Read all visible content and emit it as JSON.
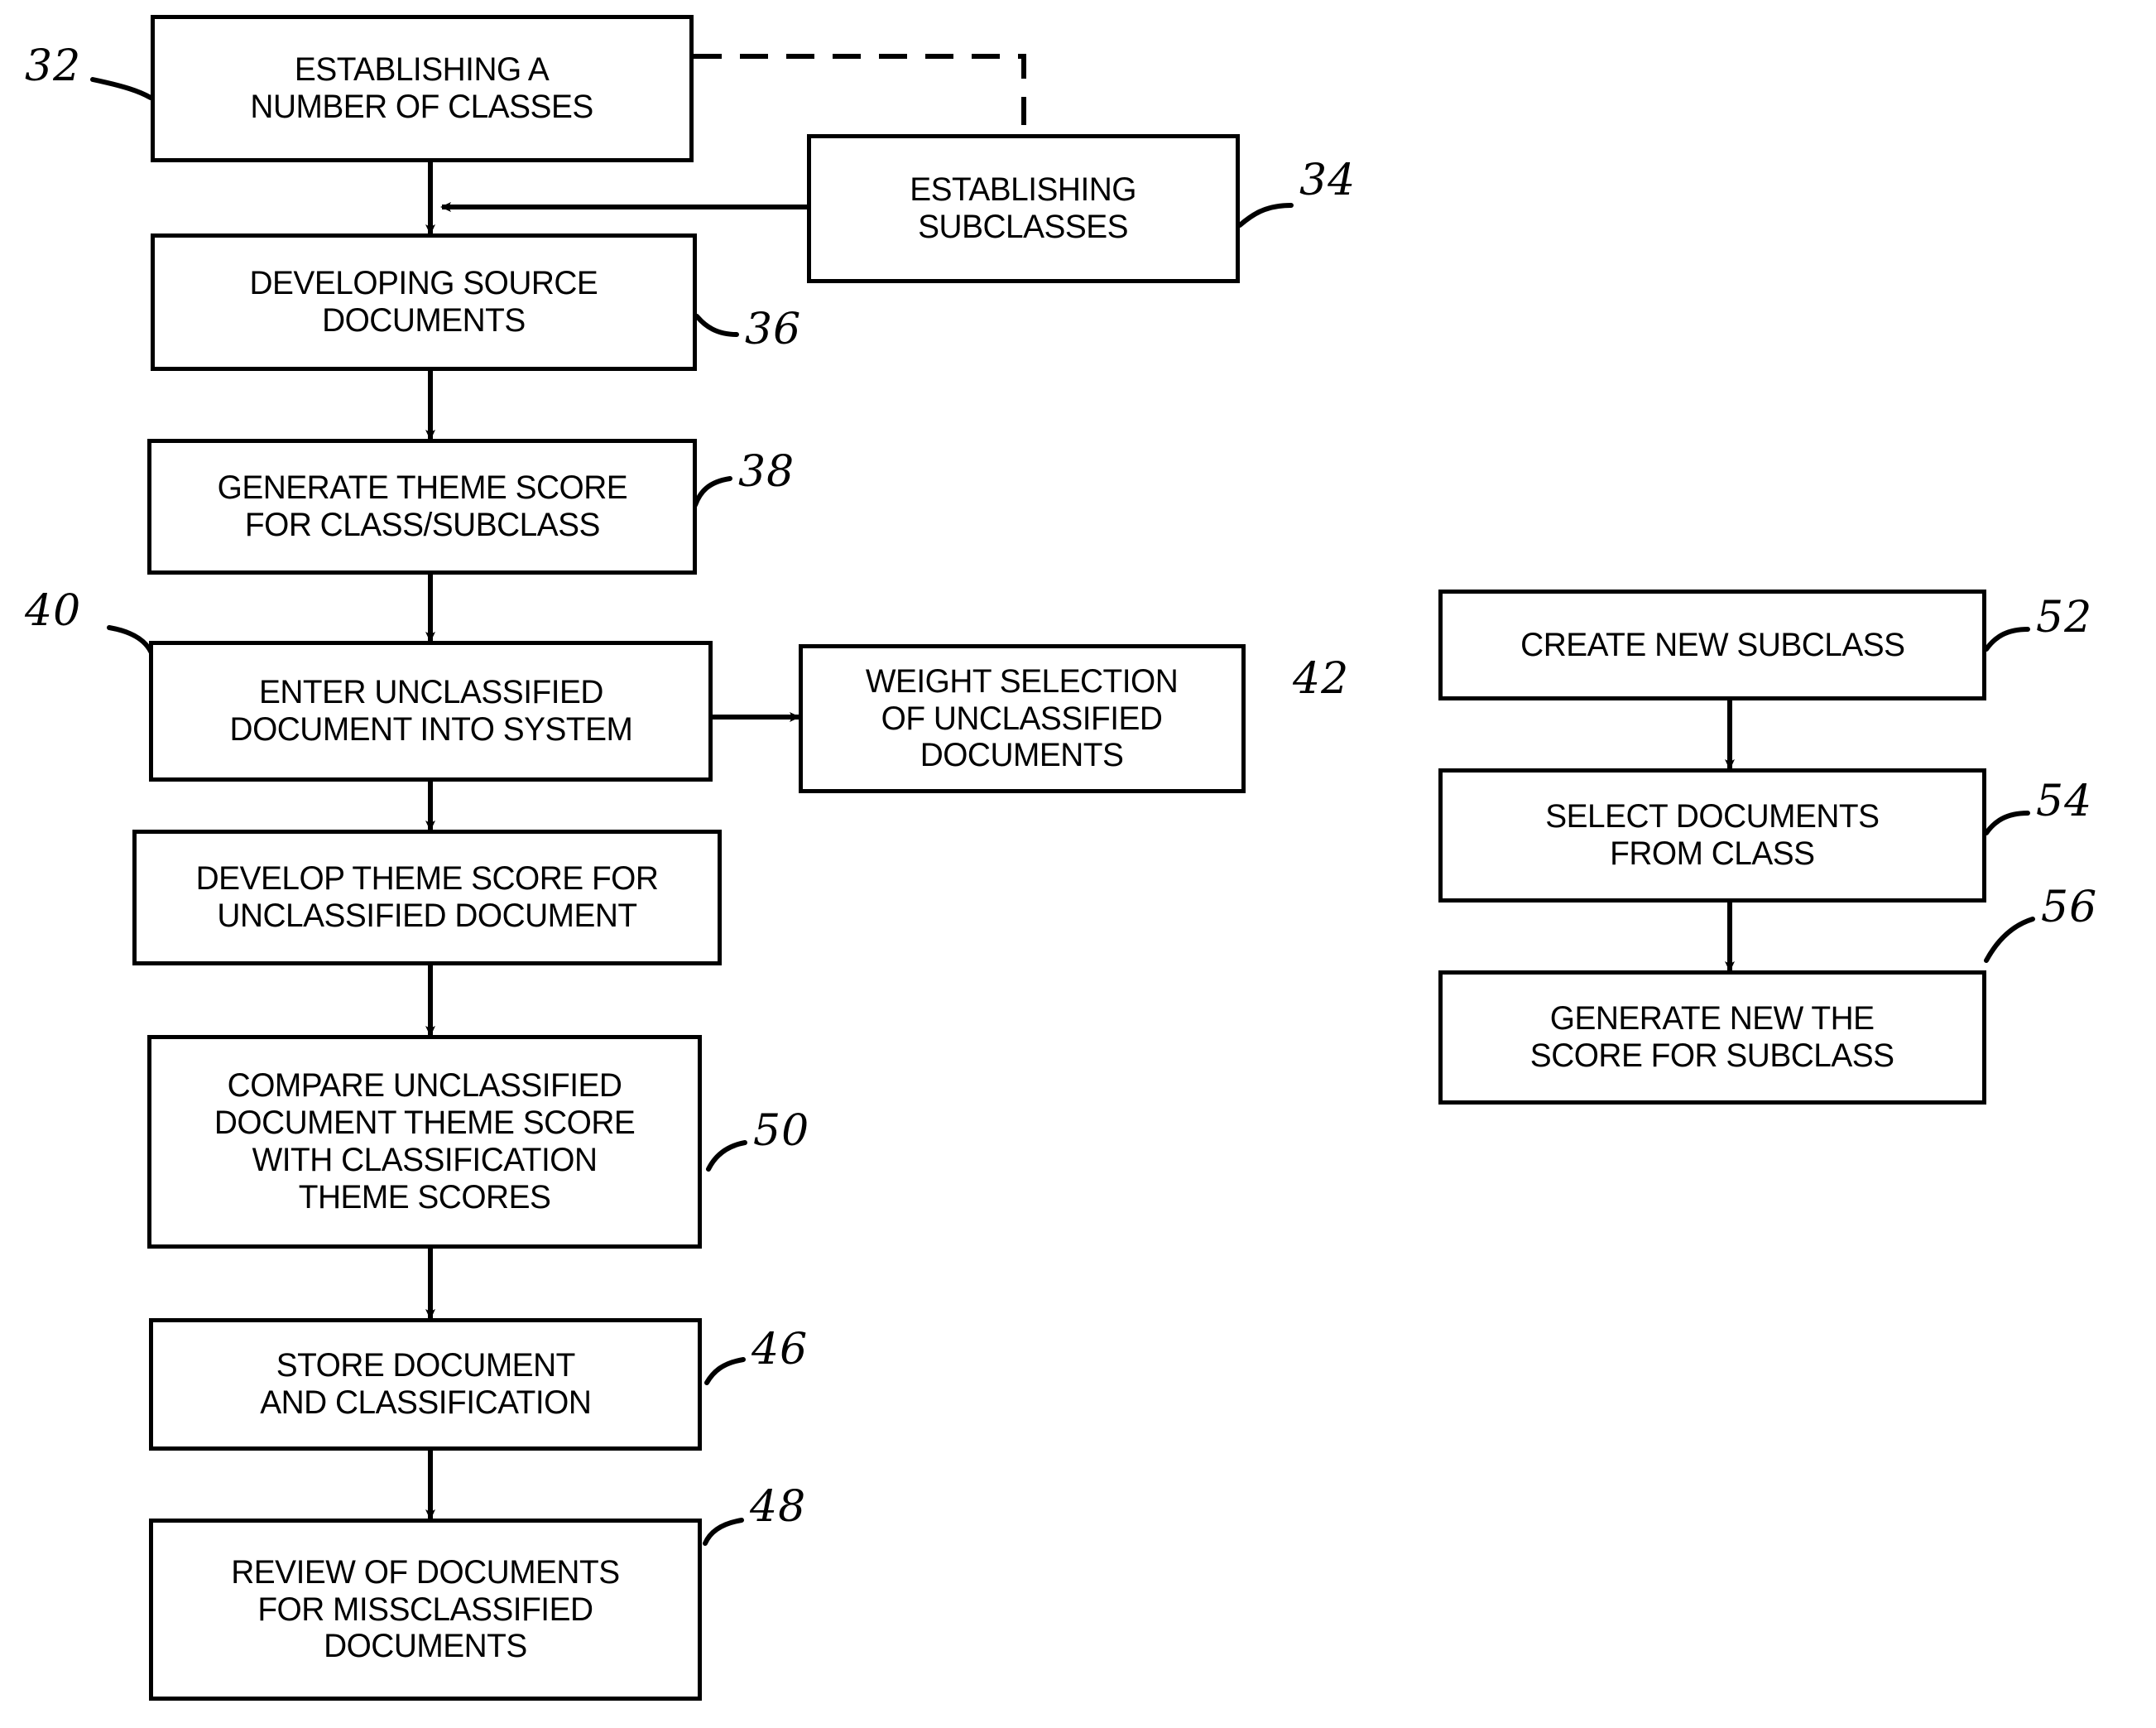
{
  "diagram": {
    "type": "patent-flowchart",
    "background_color": "#ffffff",
    "line_color": "#000000",
    "boxes": [
      {
        "id": "b32",
        "label": "ESTABLISHING A\nNUMBER OF CLASSES",
        "ref": "32"
      },
      {
        "id": "b34",
        "label": "ESTABLISHING\nSUBCLASSES",
        "ref": "34"
      },
      {
        "id": "b36",
        "label": "DEVELOPING SOURCE\nDOCUMENTS",
        "ref": "36"
      },
      {
        "id": "b38",
        "label": "GENERATE THEME SCORE\nFOR CLASS/SUBCLASS",
        "ref": "38"
      },
      {
        "id": "b40",
        "label": "ENTER UNCLASSIFIED\nDOCUMENT INTO SYSTEM",
        "ref": "40"
      },
      {
        "id": "b42",
        "label": "WEIGHT SELECTION\nOF UNCLASSIFIED\nDOCUMENTS",
        "ref": "42"
      },
      {
        "id": "b44",
        "label": "DEVELOP THEME SCORE FOR\nUNCLASSIFIED DOCUMENT",
        "ref": ""
      },
      {
        "id": "b50",
        "label": "COMPARE UNCLASSIFIED\nDOCUMENT THEME SCORE\nWITH CLASSIFICATION\nTHEME SCORES",
        "ref": "50"
      },
      {
        "id": "b46",
        "label": "STORE DOCUMENT\nAND CLASSIFICATION",
        "ref": "46"
      },
      {
        "id": "b48",
        "label": "REVIEW OF DOCUMENTS\nFOR MISSCLASSIFIED\nDOCUMENTS",
        "ref": "48"
      },
      {
        "id": "b52",
        "label": "CREATE NEW SUBCLASS",
        "ref": "52"
      },
      {
        "id": "b54",
        "label": "SELECT DOCUMENTS\nFROM CLASS",
        "ref": "54"
      },
      {
        "id": "b56",
        "label": "GENERATE NEW THE\nSCORE FOR SUBCLASS",
        "ref": "56"
      }
    ],
    "refs": {
      "r32": "32",
      "r34": "34",
      "r36": "36",
      "r38": "38",
      "r40": "40",
      "r42": "42",
      "r50": "50",
      "r46": "46",
      "r48": "48",
      "r52": "52",
      "r54": "54",
      "r56": "56"
    }
  }
}
